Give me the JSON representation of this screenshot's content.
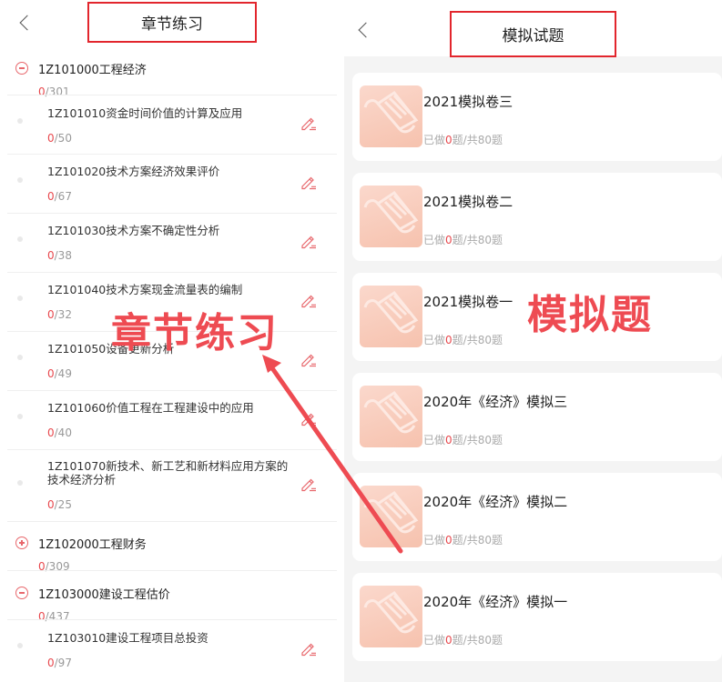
{
  "left": {
    "title": "章节练习",
    "categories": [
      {
        "title": "1Z101000工程经济",
        "done": "0",
        "total": "/301",
        "expanded": true
      },
      {
        "title": "1Z102000工程财务",
        "done": "0",
        "total": "/309",
        "expanded": false
      },
      {
        "title": "1Z103000建设工程估价",
        "done": "0",
        "total": "/437",
        "expanded": true
      }
    ],
    "items": [
      {
        "title": "1Z101010资金时间价值的计算及应用",
        "done": "0",
        "total": "/50"
      },
      {
        "title": "1Z101020技术方案经济效果评价",
        "done": "0",
        "total": "/67"
      },
      {
        "title": "1Z101030技术方案不确定性分析",
        "done": "0",
        "total": "/38"
      },
      {
        "title": "1Z101040技术方案现金流量表的编制",
        "done": "0",
        "total": "/32"
      },
      {
        "title": "1Z101050设备更新分析",
        "done": "0",
        "total": "/49"
      },
      {
        "title": "1Z101060价值工程在工程建设中的应用",
        "done": "0",
        "total": "/40"
      },
      {
        "title": "1Z101070新技术、新工艺和新材料应用方案的技术经济分析",
        "done": "0",
        "total": "/25"
      },
      {
        "title": "1Z103010建设工程项目总投资",
        "done": "0",
        "total": "/97"
      }
    ]
  },
  "right": {
    "title": "模拟试题",
    "papers": [
      {
        "title": "2021模拟卷三",
        "stat_prefix": "已做",
        "done": "0",
        "stat_suffix": "题/共80题"
      },
      {
        "title": "2021模拟卷二",
        "stat_prefix": "已做",
        "done": "0",
        "stat_suffix": "题/共80题"
      },
      {
        "title": "2021模拟卷一",
        "stat_prefix": "已做",
        "done": "0",
        "stat_suffix": "题/共80题"
      },
      {
        "title": "2020年《经济》模拟三",
        "stat_prefix": "已做",
        "done": "0",
        "stat_suffix": "题/共80题"
      },
      {
        "title": "2020年《经济》模拟二",
        "stat_prefix": "已做",
        "done": "0",
        "stat_suffix": "题/共80题"
      },
      {
        "title": "2020年《经济》模拟一",
        "stat_prefix": "已做",
        "done": "0",
        "stat_suffix": "题/共80题"
      }
    ]
  },
  "annotations": {
    "left_label": "章节练习",
    "right_label": "模拟题",
    "color": "#ee4b52"
  },
  "icons": {
    "back": "chevron-left-icon",
    "expand": "plus-circle-icon",
    "collapse": "minus-circle-icon",
    "practice": "pen-edit-icon",
    "paper": "paper-scroll-icon"
  }
}
